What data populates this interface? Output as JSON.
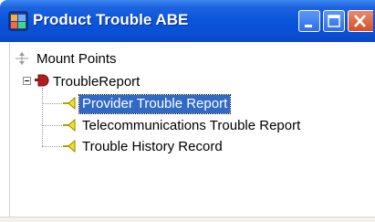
{
  "window": {
    "title": "Product Trouble ABE",
    "icon": "abe-app-icon",
    "buttons": [
      "minimize",
      "maximize",
      "close"
    ]
  },
  "tree": {
    "root": {
      "label": "Mount Points",
      "icon": "mount-points-icon"
    },
    "folder": {
      "label": "TroubleReport",
      "icon": "trouble-report-icon",
      "expanded": true
    },
    "children": [
      {
        "label": "Provider Trouble Report",
        "icon": "tree-leaf-icon",
        "selected": true
      },
      {
        "label": "Telecommunications Trouble Report",
        "icon": "tree-leaf-icon",
        "selected": false
      },
      {
        "label": "Trouble History Record",
        "icon": "tree-leaf-icon",
        "selected": false
      }
    ]
  },
  "colors": {
    "titlebar": "#0a55db",
    "selection": "#316ac5",
    "close_button": "#d4502a"
  }
}
